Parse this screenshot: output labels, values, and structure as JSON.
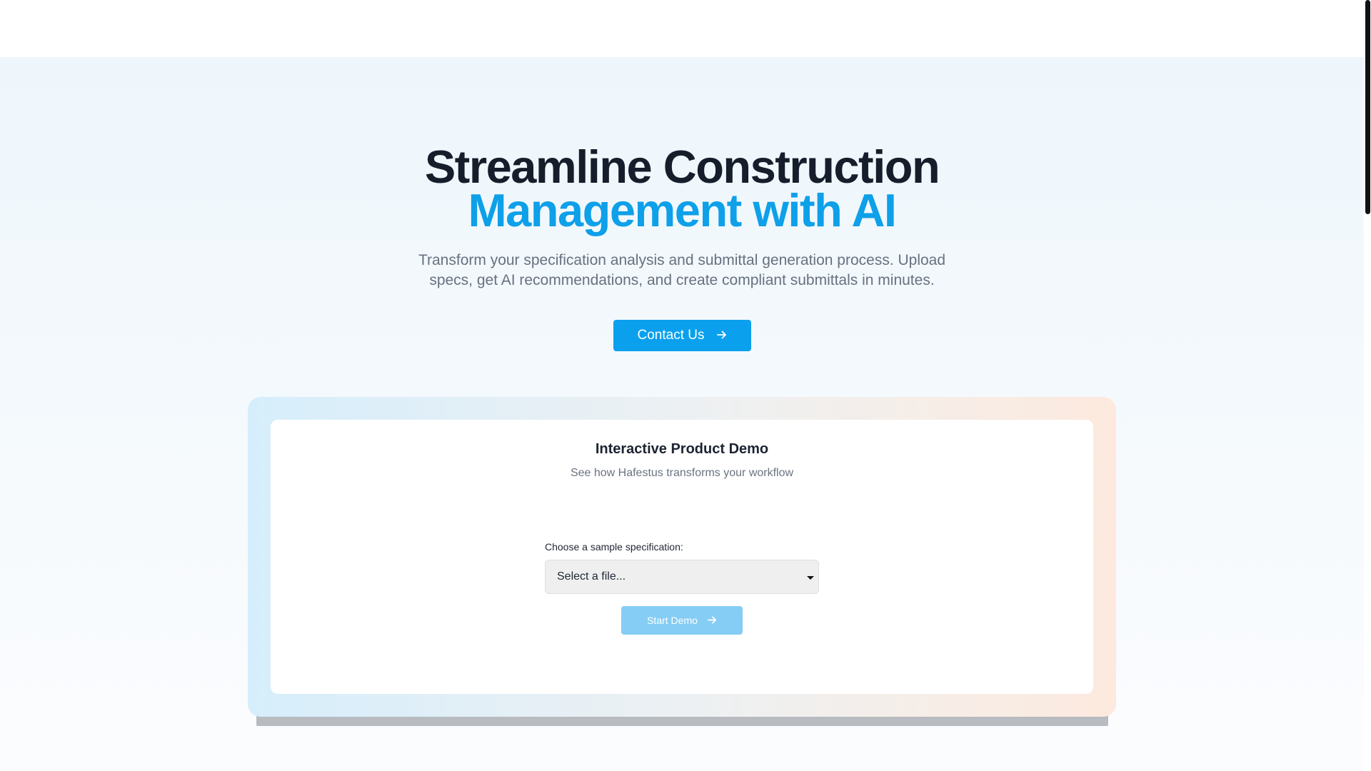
{
  "hero": {
    "title_line1": "Streamline Construction",
    "title_line2": "Management with AI",
    "subtitle": "Transform your specification analysis and submittal generation process. Upload specs, get AI recommendations, and create compliant submittals in minutes.",
    "cta_label": "Contact Us",
    "cta_icon": "arrow-right-icon"
  },
  "demo": {
    "title": "Interactive Product Demo",
    "subtitle": "See how Hafestus transforms your workflow",
    "field_label": "Choose a sample specification:",
    "select_value": "Select a file...",
    "start_label": "Start Demo",
    "start_icon": "arrow-right-icon"
  },
  "colors": {
    "accent": "#0ba0ee",
    "heading": "#161d2b",
    "body_text": "#68717f",
    "button_disabled": "#85cdf5"
  }
}
